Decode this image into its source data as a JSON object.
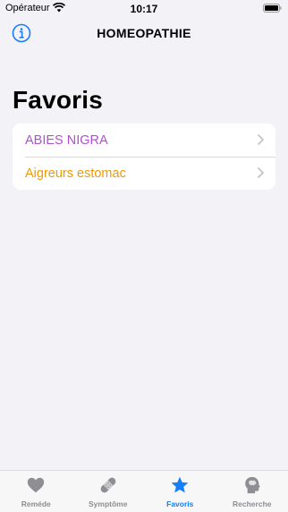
{
  "status_bar": {
    "carrier": "Opérateur",
    "time": "10:17"
  },
  "nav": {
    "title": "HOMEOPATHIE",
    "info_icon": "info-icon"
  },
  "page": {
    "title": "Favoris"
  },
  "favorites": [
    {
      "label": "ABIES NIGRA",
      "color": "#b04fd0"
    },
    {
      "label": "Aigreurs estomac",
      "color": "#f09a00"
    }
  ],
  "tab_bar": {
    "active_color": "#147efb",
    "inactive_color": "#8e8e93",
    "tabs": [
      {
        "label": "Reméde",
        "icon": "heart-icon",
        "active": false
      },
      {
        "label": "Symptôme",
        "icon": "bandage-icon",
        "active": false
      },
      {
        "label": "Favoris",
        "icon": "star-icon",
        "active": true
      },
      {
        "label": "Recherche",
        "icon": "brain-head-icon",
        "active": false
      }
    ]
  }
}
